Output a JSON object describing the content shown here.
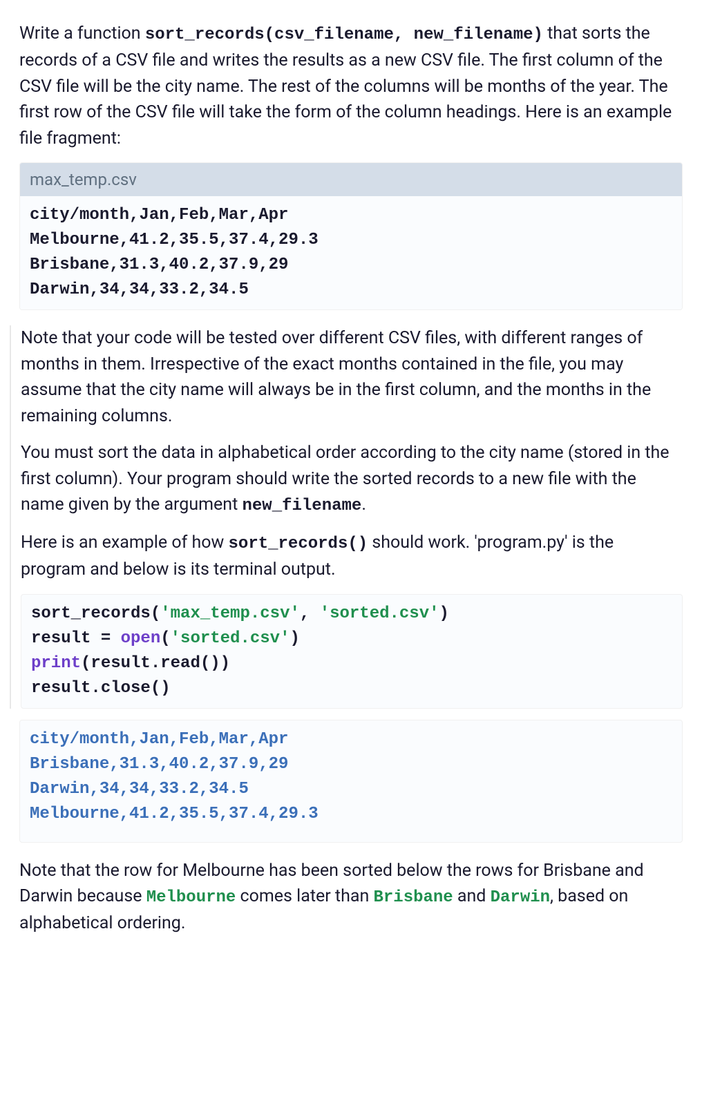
{
  "intro": {
    "pre": "Write a function ",
    "fn_signature": "sort_records(csv_filename, new_filename)",
    "post": " that sorts the records of a CSV file and writes the results as a new CSV file. The first column of the CSV file will be the city name. The rest of the columns will be months of the year. The first row of the CSV file will take the form of the column headings. Here is an example file fragment:"
  },
  "example_file": {
    "filename": "max_temp.csv",
    "content": "city/month,Jan,Feb,Mar,Apr\nMelbourne,41.2,35.5,37.4,29.3\nBrisbane,31.3,40.2,37.9,29\nDarwin,34,34,33.2,34.5"
  },
  "para_note": "Note that your code will be tested over different CSV files, with different ranges of months in them. Irrespective of the exact months contained in the file, you may assume that the city name will always be in the first column, and the months in the remaining columns.",
  "para_sort": {
    "pre": "You must sort the data in alphabetical order according to the city name (stored in the first column). Your program should write the sorted records to a new file with the name given by the argument ",
    "arg": "new_filename",
    "post": "."
  },
  "para_example_intro": {
    "pre": "Here is an example of how ",
    "fn": "sort_records()",
    "post": " should work. 'program.py' is the program and below is its terminal output."
  },
  "code_example": {
    "line1_pre": "sort_records(",
    "line1_arg1": "'max_temp.csv'",
    "line1_mid": ", ",
    "line1_arg2": "'sorted.csv'",
    "line1_post": ")",
    "line2_pre": "result = ",
    "line2_fn": "open",
    "line2_open": "(",
    "line2_arg": "'sorted.csv'",
    "line2_close": ")",
    "line3_fn": "print",
    "line3_post": "(result.read())",
    "line4": "result.close()"
  },
  "output": "city/month,Jan,Feb,Mar,Apr\nBrisbane,31.3,40.2,37.9,29\nDarwin,34,34,33.2,34.5\nMelbourne,41.2,35.5,37.4,29.3",
  "conclusion": {
    "pre": "Note that the row for Melbourne has been sorted below the rows for Brisbane and Darwin because ",
    "c1": "Melbourne",
    "mid1": " comes later than ",
    "c2": "Brisbane",
    "mid2": " and ",
    "c3": "Darwin",
    "post": ", based on alphabetical ordering."
  }
}
